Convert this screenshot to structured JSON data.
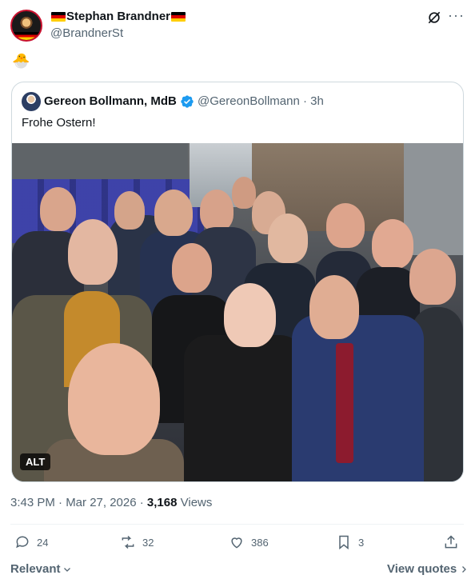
{
  "post": {
    "author_name": "Stephan Brandner",
    "author_handle": "@BrandnerSt",
    "body_emoji": "🐣",
    "timestamp": "3:43 PM · Mar 27, 2026 · ",
    "views_count": "3,168",
    "views_label": " Views"
  },
  "quote": {
    "author_name": "Gereon Bollmann, MdB",
    "author_handle": "@GereonBollmann · 3h",
    "text": "Frohe Ostern!",
    "alt_badge": "ALT"
  },
  "actions": {
    "replies": "24",
    "reposts": "32",
    "likes": "386",
    "bookmarks": "3"
  },
  "footer": {
    "relevant_label": "Relevant",
    "view_quotes_label": "View quotes"
  },
  "icons": {
    "more": "more-icon",
    "grok": "grok-icon",
    "reply": "reply-icon",
    "repost": "repost-icon",
    "like": "heart-icon",
    "bookmark": "bookmark-icon",
    "share": "share-icon",
    "verified": "verified-badge-icon"
  },
  "colors": {
    "text_primary": "#0f1419",
    "text_secondary": "#536471",
    "verified_blue": "#1d9bf0",
    "border": "#cfd9de"
  }
}
